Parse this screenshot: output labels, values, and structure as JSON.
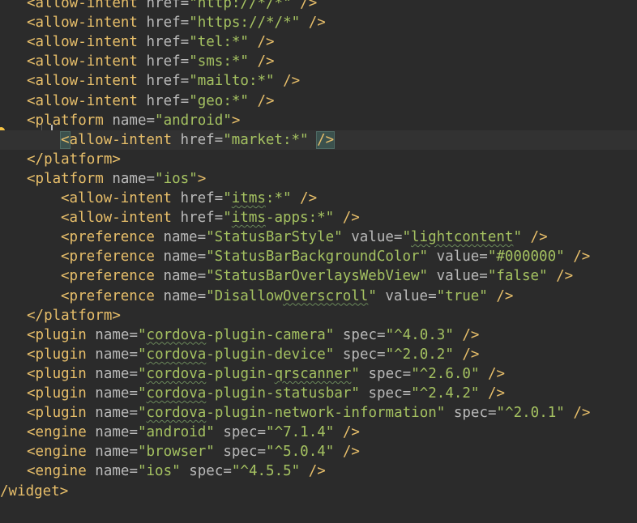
{
  "editor": {
    "colors": {
      "background": "#2b2b2b",
      "tag": "#e8bf6a",
      "attribute": "#bababa",
      "string": "#a5c261",
      "current_line": "#323232"
    },
    "gutter_icon": "lightbulb-icon",
    "lines": [
      [
        [
          "t",
          "<allow-intent "
        ],
        [
          "a",
          "href="
        ],
        [
          "s",
          "\"http://*/*\""
        ],
        [
          "t",
          " />"
        ]
      ],
      [
        [
          "t",
          "<allow-intent "
        ],
        [
          "a",
          "href="
        ],
        [
          "s",
          "\"https://*/*\""
        ],
        [
          "t",
          " />"
        ]
      ],
      [
        [
          "t",
          "<allow-intent "
        ],
        [
          "a",
          "href="
        ],
        [
          "s",
          "\"tel:*\""
        ],
        [
          "t",
          " />"
        ]
      ],
      [
        [
          "t",
          "<allow-intent "
        ],
        [
          "a",
          "href="
        ],
        [
          "s",
          "\"sms:*\""
        ],
        [
          "t",
          " />"
        ]
      ],
      [
        [
          "t",
          "<allow-intent "
        ],
        [
          "a",
          "href="
        ],
        [
          "s",
          "\"mailto:*\""
        ],
        [
          "t",
          " />"
        ]
      ],
      [
        [
          "t",
          "<allow-intent "
        ],
        [
          "a",
          "href="
        ],
        [
          "s",
          "\"geo:*\""
        ],
        [
          "t",
          " />"
        ]
      ],
      [
        [
          "t",
          "<platform "
        ],
        [
          "a",
          "name="
        ],
        [
          "s",
          "\"android\""
        ],
        [
          "t",
          ">"
        ]
      ],
      [
        [
          "tb",
          "<"
        ],
        [
          "t",
          "allow-intent "
        ],
        [
          "a",
          "href="
        ],
        [
          "s",
          "\"market:*\""
        ],
        [
          "t",
          " "
        ],
        [
          "tb",
          "/>"
        ]
      ],
      [
        [
          "t",
          "</platform>"
        ]
      ],
      [
        [
          "t",
          "<platform "
        ],
        [
          "a",
          "name="
        ],
        [
          "s",
          "\"ios\""
        ],
        [
          "t",
          ">"
        ]
      ],
      [
        [
          "t",
          "<allow-intent "
        ],
        [
          "a",
          "href="
        ],
        [
          "s",
          "\""
        ],
        [
          "sq",
          "itms"
        ],
        [
          "s",
          ":*\""
        ],
        [
          "t",
          " />"
        ]
      ],
      [
        [
          "t",
          "<allow-intent "
        ],
        [
          "a",
          "href="
        ],
        [
          "s",
          "\""
        ],
        [
          "sq",
          "itms"
        ],
        [
          "s",
          "-apps:*\""
        ],
        [
          "t",
          " />"
        ]
      ],
      [
        [
          "t",
          "<preference "
        ],
        [
          "a",
          "name="
        ],
        [
          "s",
          "\"StatusBarStyle\""
        ],
        [
          "a",
          " value="
        ],
        [
          "s",
          "\""
        ],
        [
          "sq",
          "lightcontent"
        ],
        [
          "s",
          "\""
        ],
        [
          "t",
          " />"
        ]
      ],
      [
        [
          "t",
          "<preference "
        ],
        [
          "a",
          "name="
        ],
        [
          "s",
          "\"StatusBarBackgroundColor\""
        ],
        [
          "a",
          " value="
        ],
        [
          "s",
          "\"#000000\""
        ],
        [
          "t",
          " />"
        ]
      ],
      [
        [
          "t",
          "<preference "
        ],
        [
          "a",
          "name="
        ],
        [
          "s",
          "\"StatusBarOverlaysWebView\""
        ],
        [
          "a",
          " value="
        ],
        [
          "s",
          "\"false\""
        ],
        [
          "t",
          " />"
        ]
      ],
      [
        [
          "t",
          "<preference "
        ],
        [
          "a",
          "name="
        ],
        [
          "s",
          "\"Disallow"
        ],
        [
          "sq",
          "Overscroll"
        ],
        [
          "s",
          "\""
        ],
        [
          "a",
          " value="
        ],
        [
          "s",
          "\"true\""
        ],
        [
          "t",
          " />"
        ]
      ],
      [
        [
          "t",
          "</platform>"
        ]
      ],
      [
        [
          "t",
          "<plugin "
        ],
        [
          "a",
          "name="
        ],
        [
          "s",
          "\""
        ],
        [
          "sq",
          "cordova"
        ],
        [
          "s",
          "-plugin-camera\""
        ],
        [
          "a",
          " spec="
        ],
        [
          "s",
          "\"^4.0.3\""
        ],
        [
          "t",
          " />"
        ]
      ],
      [
        [
          "t",
          "<plugin "
        ],
        [
          "a",
          "name="
        ],
        [
          "s",
          "\""
        ],
        [
          "sq",
          "cordova"
        ],
        [
          "s",
          "-plugin-device\""
        ],
        [
          "a",
          " spec="
        ],
        [
          "s",
          "\"^2.0.2\""
        ],
        [
          "t",
          " />"
        ]
      ],
      [
        [
          "t",
          "<plugin "
        ],
        [
          "a",
          "name="
        ],
        [
          "s",
          "\""
        ],
        [
          "sq",
          "cordova"
        ],
        [
          "s",
          "-plugin-"
        ],
        [
          "sq",
          "qrscanner"
        ],
        [
          "s",
          "\""
        ],
        [
          "a",
          " spec="
        ],
        [
          "s",
          "\"^2.6.0\""
        ],
        [
          "t",
          " />"
        ]
      ],
      [
        [
          "t",
          "<plugin "
        ],
        [
          "a",
          "name="
        ],
        [
          "s",
          "\""
        ],
        [
          "sq",
          "cordova"
        ],
        [
          "s",
          "-plugin-statusbar\""
        ],
        [
          "a",
          " spec="
        ],
        [
          "s",
          "\"^2.4.2\""
        ],
        [
          "t",
          " />"
        ]
      ],
      [
        [
          "t",
          "<plugin "
        ],
        [
          "a",
          "name="
        ],
        [
          "s",
          "\""
        ],
        [
          "sq",
          "cordova"
        ],
        [
          "s",
          "-plugin-network-information\""
        ],
        [
          "a",
          " spec="
        ],
        [
          "s",
          "\"^2.0.1\""
        ],
        [
          "t",
          " />"
        ]
      ],
      [
        [
          "t",
          "<engine "
        ],
        [
          "a",
          "name="
        ],
        [
          "s",
          "\"android\""
        ],
        [
          "a",
          " spec="
        ],
        [
          "s",
          "\"^7.1.4\""
        ],
        [
          "t",
          " />"
        ]
      ],
      [
        [
          "t",
          "<engine "
        ],
        [
          "a",
          "name="
        ],
        [
          "s",
          "\"browser\""
        ],
        [
          "a",
          " spec="
        ],
        [
          "s",
          "\"^5.0.4\""
        ],
        [
          "t",
          " />"
        ]
      ],
      [
        [
          "t",
          "<engine "
        ],
        [
          "a",
          "name="
        ],
        [
          "s",
          "\"ios\""
        ],
        [
          "a",
          " spec="
        ],
        [
          "s",
          "\"^4.5.5\""
        ],
        [
          "t",
          " />"
        ]
      ],
      [
        [
          "t",
          "/widget>"
        ]
      ]
    ]
  }
}
